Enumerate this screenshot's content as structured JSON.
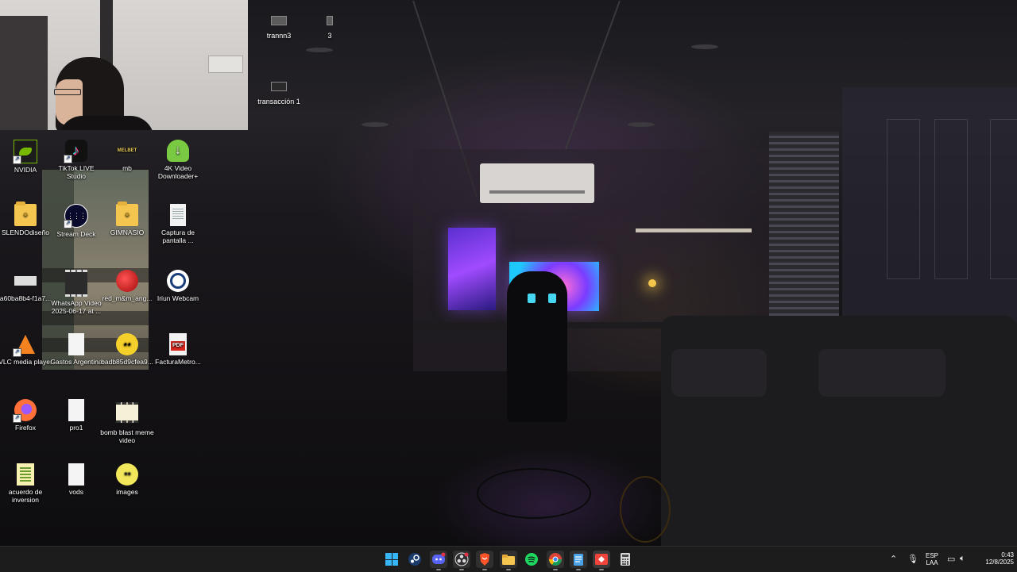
{
  "top_items": [
    {
      "label": "trannn3",
      "icon": "window-thumbnail-icon"
    },
    {
      "label": "3",
      "icon": "window-thumbnail-icon"
    },
    {
      "label": "transacción 1",
      "icon": "window-thumbnail-icon"
    }
  ],
  "desktop_icons": [
    {
      "label": "NVIDIA",
      "icon": "nvidia-icon"
    },
    {
      "label": "TikTok LIVE Studio",
      "icon": "tiktok-icon"
    },
    {
      "label": "mb",
      "icon": "melbet-icon"
    },
    {
      "label": "4K Video Downloader+",
      "icon": "download-cloud-icon"
    },
    {
      "label": "SLENDOdiseño",
      "icon": "folder-icon"
    },
    {
      "label": "Stream Deck",
      "icon": "stream-deck-icon"
    },
    {
      "label": "GIMNASIO",
      "icon": "folder-icon"
    },
    {
      "label": "Captura de pantalla ...",
      "icon": "document-icon"
    },
    {
      "label": "a60ba8b4-f1a7...",
      "icon": "image-icon"
    },
    {
      "label": "WhatsApp Video 2025-06-17 at ...",
      "icon": "video-icon"
    },
    {
      "label": "red_m&m_ang...",
      "icon": "image-icon"
    },
    {
      "label": "Iriun Webcam",
      "icon": "webcam-icon"
    },
    {
      "label": "VLC media player",
      "icon": "vlc-icon"
    },
    {
      "label": "Gastos Argentina",
      "icon": "blank-document-icon"
    },
    {
      "label": "badb85d9cfea9...",
      "icon": "emoji-image-icon"
    },
    {
      "label": "FacturaMetro...",
      "icon": "pdf-icon"
    },
    {
      "label": "Firefox",
      "icon": "firefox-icon"
    },
    {
      "label": "pro1",
      "icon": "blank-document-icon"
    },
    {
      "label": "bomb blast meme video",
      "icon": "film-icon"
    },
    {
      "label": "acuerdo de inversion",
      "icon": "spreadsheet-document-icon"
    },
    {
      "label": "vods",
      "icon": "blank-document-icon"
    },
    {
      "label": "images",
      "icon": "cartoon-face-icon"
    }
  ],
  "taskbar": {
    "apps": [
      {
        "name": "start-button",
        "icon": "windows-icon"
      },
      {
        "name": "steam",
        "icon": "steam-icon"
      },
      {
        "name": "discord",
        "icon": "discord-icon"
      },
      {
        "name": "obs-studio",
        "icon": "obs-icon"
      },
      {
        "name": "brave",
        "icon": "brave-icon"
      },
      {
        "name": "file-explorer",
        "icon": "folder-icon"
      },
      {
        "name": "spotify",
        "icon": "spotify-icon"
      },
      {
        "name": "chrome",
        "icon": "chrome-icon"
      },
      {
        "name": "notepad",
        "icon": "notepad-icon"
      },
      {
        "name": "anydesk",
        "icon": "anydesk-icon"
      },
      {
        "name": "calculator",
        "icon": "calculator-icon"
      }
    ],
    "tray": {
      "language": "ESP",
      "layout": "LAA",
      "time": "0:43",
      "date": "12/8/2025"
    }
  },
  "colors": {
    "taskbar_bg": "#1c1c1c",
    "windows_blue": "#36b6f6",
    "wallpaper_accent": "#8a4bff"
  }
}
